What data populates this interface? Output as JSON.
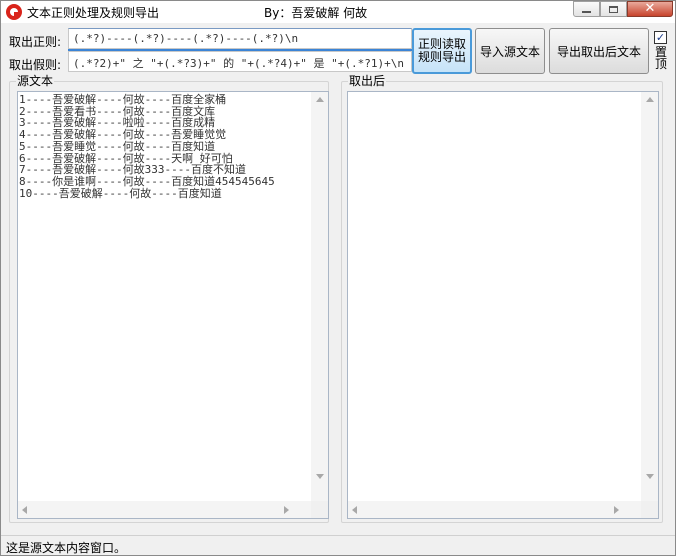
{
  "window": {
    "title": "文本正则处理及规则导出",
    "author": "By：吾爱破解  何故",
    "close_glyph": "✕"
  },
  "rules": {
    "regex_label": "取出正则:",
    "regex_value": "(.*?)----(.*?)----(.*?)----(.*?)\\n",
    "fake_label": "取出假则:",
    "fake_value": "(.*?2)+\" 之 \"+(.*?3)+\" 的 \"+(.*?4)+\" 是 \"+(.*?1)+\\n"
  },
  "toolbar": {
    "rule_export_label": "正则读取规则导出",
    "import_label": "导入源文本",
    "export_label": "导出取出后文本",
    "topmost_label": "置顶",
    "topmost_checked": "✓"
  },
  "source": {
    "title": "源文本",
    "lines": [
      "1----吾爱破解----何故----百度全家桶",
      "2----吾爱看书----何故----百度文库",
      "3----吾爱破解----啦啦----百度成精",
      "4----吾爱破解----何故----吾爱睡觉觉",
      "5----吾爱睡觉----何故----百度知道",
      "6----吾爱破解----何故----天啊 好可怕",
      "7----吾爱破解----何故333----百度不知道",
      "8----你是谁啊----何故----百度知道454545645",
      "10----吾爱破解----何故----百度知道"
    ]
  },
  "output": {
    "title": "取出后"
  },
  "status": {
    "text": "这是源文本内容窗口。"
  }
}
